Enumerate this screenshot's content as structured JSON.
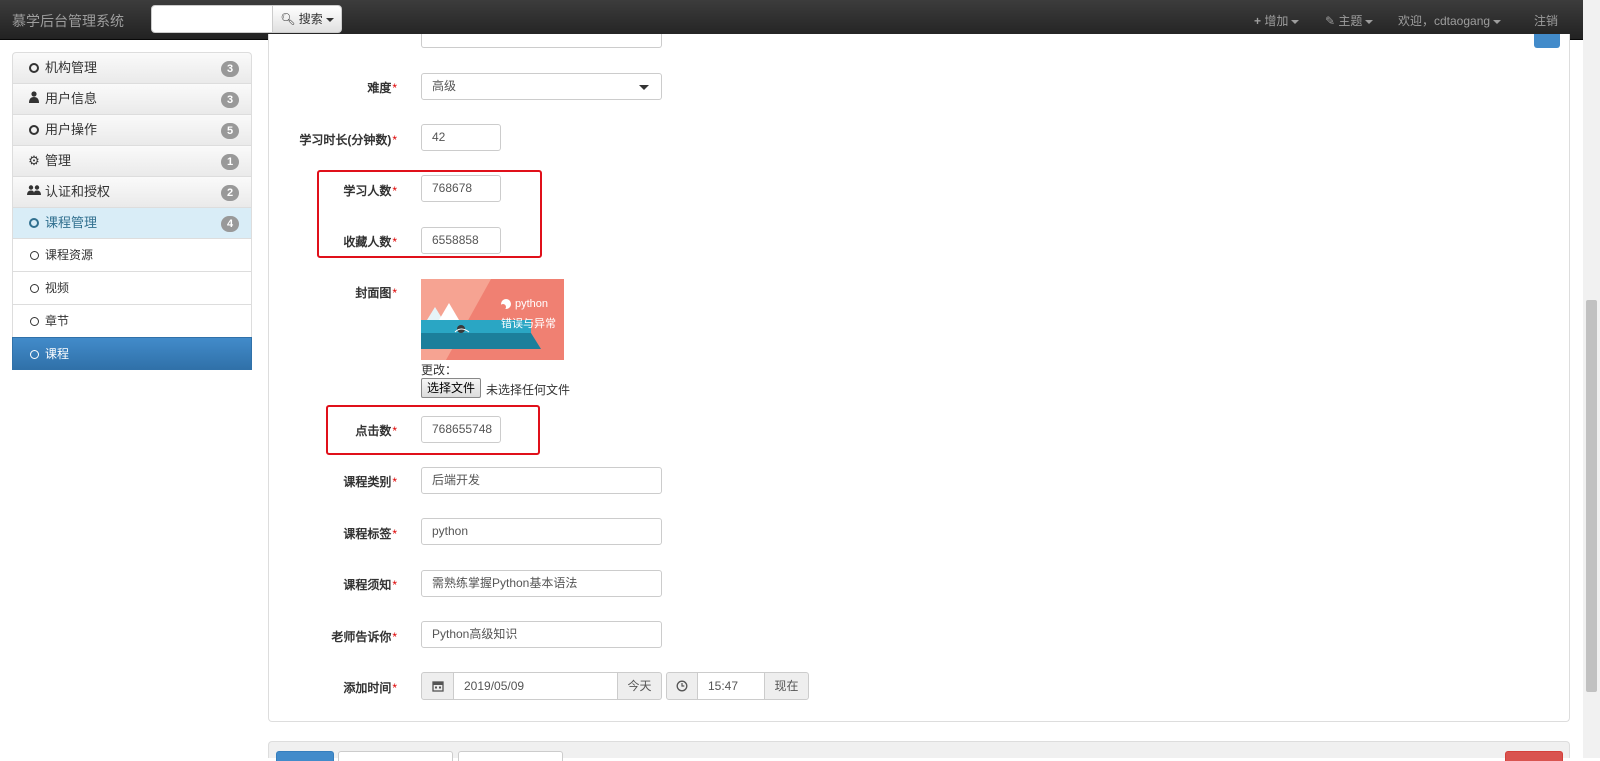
{
  "navbar": {
    "brand": "慕学后台管理系统",
    "search_value": "",
    "search_button": "搜索",
    "add_menu": "增加",
    "theme_menu": "主题",
    "welcome": "欢迎，cdtaogang",
    "logout": "注销"
  },
  "sidebar": {
    "groups": [
      {
        "label": "机构管理",
        "badge": "3",
        "icon": "circle-icon"
      },
      {
        "label": "用户信息",
        "badge": "3",
        "icon": "user-icon"
      },
      {
        "label": "用户操作",
        "badge": "5",
        "icon": "circle-icon"
      },
      {
        "label": "管理",
        "badge": "1",
        "icon": "gear-icon"
      },
      {
        "label": "认证和授权",
        "badge": "2",
        "icon": "users-icon"
      },
      {
        "label": "课程管理",
        "badge": "4",
        "icon": "circle-icon"
      }
    ],
    "sub_items": [
      {
        "label": "课程资源"
      },
      {
        "label": "视频"
      },
      {
        "label": "章节"
      },
      {
        "label": "课程"
      }
    ]
  },
  "form": {
    "difficulty": {
      "label": "难度",
      "value": "高级"
    },
    "learn_time": {
      "label": "学习时长(分钟数)",
      "value": "42"
    },
    "students": {
      "label": "学习人数",
      "value": "768678"
    },
    "favorites": {
      "label": "收藏人数",
      "value": "6558858"
    },
    "cover": {
      "label": "封面图",
      "image_title": "python",
      "image_caption": "错误与异常",
      "change_label": "更改：",
      "file_button": "选择文件",
      "file_status": "未选择任何文件"
    },
    "clicks": {
      "label": "点击数",
      "value": "768655748"
    },
    "category": {
      "label": "课程类别",
      "value": "后端开发"
    },
    "tag": {
      "label": "课程标签",
      "value": "python"
    },
    "notice": {
      "label": "课程须知",
      "value": "需熟练掌握Python基本语法"
    },
    "teacher_tell": {
      "label": "老师告诉你",
      "value": "Python高级知识"
    },
    "add_time": {
      "label": "添加时间",
      "date": "2019/05/09",
      "today_button": "今天",
      "time": "15:47",
      "now_button": "现在"
    },
    "required_mark": "*"
  },
  "colors": {
    "highlight_box": "#e0101a",
    "active_blue": "#428bca",
    "required": "#dd0000"
  }
}
